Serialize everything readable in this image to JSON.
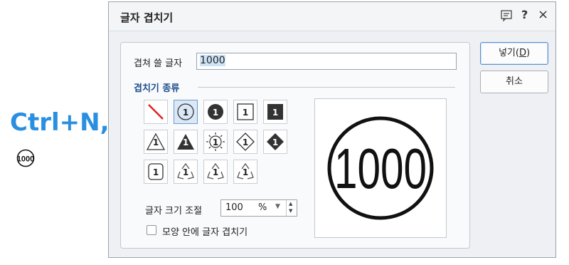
{
  "shortcut": "Ctrl+N,K",
  "dialog": {
    "title": "글자 겹치기",
    "help_glyph": "?",
    "close_glyph": "×"
  },
  "form": {
    "text_label": "겹쳐 쓸 글자",
    "text_value": "1000",
    "section_title": "겹치기 종류",
    "size_label": "글자 크기 조절",
    "size_value": "100",
    "size_unit": "%",
    "checkbox_label": "모양 안에 글자 겹치기",
    "checkbox_checked": false
  },
  "shapes": [
    {
      "id": "none",
      "icon": "no-shape-icon",
      "glyph": ""
    },
    {
      "id": "circle",
      "icon": "circle-outline-icon",
      "glyph": "1",
      "selected": true
    },
    {
      "id": "circle-filled",
      "icon": "circle-filled-icon",
      "glyph": "1"
    },
    {
      "id": "square",
      "icon": "square-outline-icon",
      "glyph": "1"
    },
    {
      "id": "square-filled",
      "icon": "square-filled-icon",
      "glyph": "1"
    },
    {
      "id": "triangle",
      "icon": "triangle-outline-icon",
      "glyph": "1"
    },
    {
      "id": "triangle-filled",
      "icon": "triangle-filled-icon",
      "glyph": "1"
    },
    {
      "id": "sun",
      "icon": "sun-icon",
      "glyph": "1"
    },
    {
      "id": "diamond",
      "icon": "diamond-outline-icon",
      "glyph": "1"
    },
    {
      "id": "diamond-filled",
      "icon": "diamond-filled-icon",
      "glyph": "1"
    },
    {
      "id": "rounded-square",
      "icon": "rounded-square-icon",
      "glyph": "1"
    },
    {
      "id": "recycle-1",
      "icon": "recycle-icon",
      "glyph": "1"
    },
    {
      "id": "recycle-2",
      "icon": "recycle-icon",
      "glyph": "1"
    },
    {
      "id": "recycle-3",
      "icon": "recycle-icon",
      "glyph": "1"
    }
  ],
  "preview_text": "1000",
  "buttons": {
    "insert_pre": "넣기(",
    "insert_key": "D",
    "insert_post": ")",
    "cancel": "취소"
  },
  "colors": {
    "accent": "#2a8fe0",
    "section": "#1f4f8f",
    "none_slash": "#e02020"
  }
}
